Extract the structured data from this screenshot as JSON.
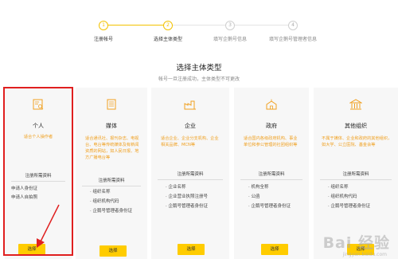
{
  "steps": [
    {
      "num": "1",
      "label": "注册帐号",
      "state": "done"
    },
    {
      "num": "2",
      "label": "选择主体类型",
      "state": "current"
    },
    {
      "num": "3",
      "label": "填写企鹅号信息",
      "state": "todo"
    },
    {
      "num": "4",
      "label": "填写企鹅号管理者信息",
      "state": "todo"
    }
  ],
  "title": "选择主体类型",
  "subtitle": "帐号一旦注册成功，主体类型不可更改",
  "cards": [
    {
      "name": "个人",
      "icon": "id-card-icon",
      "desc": "适合个人操作者",
      "req_title": "注册所需资料",
      "requirements": [
        "申请人身份证",
        "申请人自拍照"
      ],
      "button": "选择"
    },
    {
      "name": "媒体",
      "icon": "newspaper-icon",
      "desc": "适合通讯社、报刊杂志、电视台、电台等传统媒体及有新闻资质的网站，如人民日报、地方广播电台等",
      "req_title": "注册所需资料",
      "requirements": [
        "组织名称",
        "组织机构代码",
        "企鹅号管理者身份证"
      ],
      "button": "选择"
    },
    {
      "name": "企业",
      "icon": "factory-icon",
      "desc": "适合企业、企业分支机构、企业相关品牌、MCN等",
      "req_title": "注册所需资料",
      "requirements": [
        "企业名称",
        "企业营业执照注册号",
        "企鹅号管理者身份证"
      ],
      "button": "选择"
    },
    {
      "name": "政府",
      "icon": "government-building-icon",
      "desc": "适合国内各级政府机构、事业单位和参公管理的社团组织等",
      "req_title": "注册所需资料",
      "requirements": [
        "机构全称",
        "公函",
        "企鹅号管理者身份证"
      ],
      "button": "选择"
    },
    {
      "name": "其他组织",
      "icon": "institution-icon",
      "desc": "不属于媒体、企业和政府的其他组织，如大学、公立医院、基金会等",
      "req_title": "注册所需资料",
      "requirements": [
        "组织名称",
        "组织机构代码",
        "企鹅号管理者身份证"
      ],
      "button": "选择"
    }
  ],
  "watermark": {
    "text": "Bai 经验",
    "sub": "jingyan.baidu.com"
  },
  "colors": {
    "accent": "#ffcc00",
    "step_done": "#f3c200",
    "highlight": "#e02020",
    "desc_text": "#f0a020",
    "card_bg": "#f7f7f7"
  }
}
